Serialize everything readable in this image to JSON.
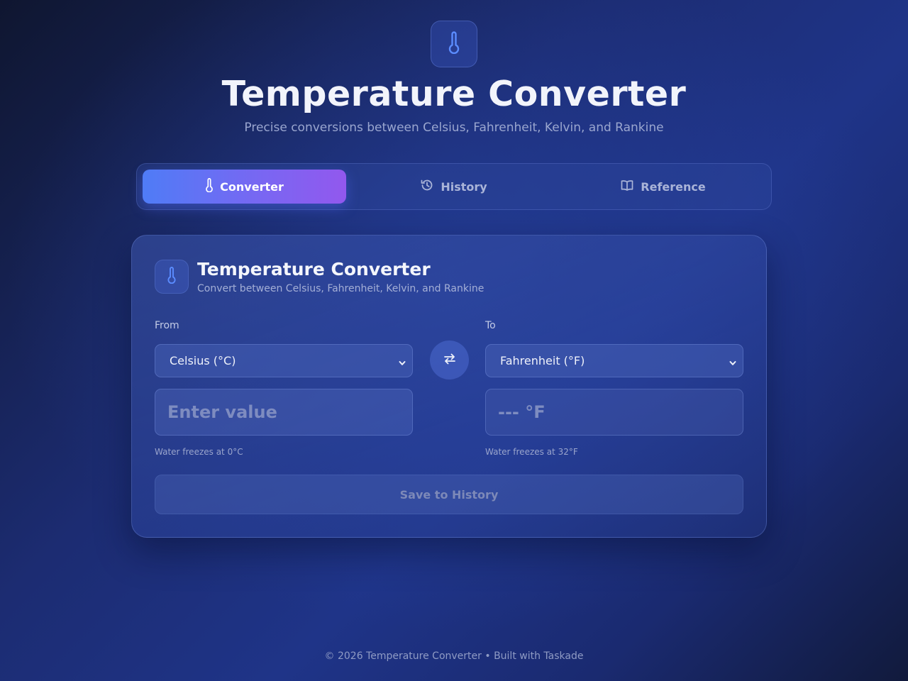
{
  "header": {
    "logo_icon": "thermometer-icon",
    "title": "Temperature Converter",
    "subtitle": "Precise conversions between Celsius, Fahrenheit, Kelvin, and Rankine"
  },
  "tabs": [
    {
      "label": "Converter",
      "icon": "thermometer-icon",
      "active": true
    },
    {
      "label": "History",
      "icon": "history-icon",
      "active": false
    },
    {
      "label": "Reference",
      "icon": "book-icon",
      "active": false
    }
  ],
  "converter": {
    "icon": "thermometer-icon",
    "title": "Temperature Converter",
    "subtitle": "Convert between Celsius, Fahrenheit, Kelvin, and Rankine",
    "from_label": "From",
    "to_label": "To",
    "from_unit": "Celsius (°C)",
    "to_unit": "Fahrenheit (°F)",
    "input_value": "",
    "input_placeholder": "Enter value",
    "output_placeholder": "--- °F",
    "from_hint": "Water freezes at 0°C",
    "to_hint": "Water freezes at 32°F",
    "save_label": "Save to History"
  },
  "footer": {
    "text": "© 2026 Temperature Converter • Built with Taskade"
  },
  "colors": {
    "accent_start": "#4f7cf6",
    "accent_end": "#9258ee",
    "icon_blue": "#5b8cff",
    "background": "#1c2c72"
  }
}
